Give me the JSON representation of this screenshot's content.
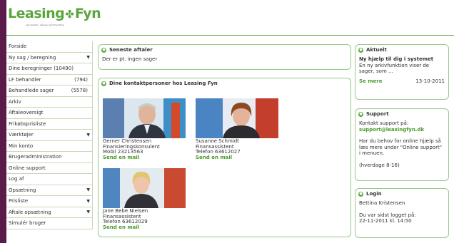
{
  "brand": {
    "name_a": "Leasing",
    "name_b": "Fyn",
    "tagline": "specialister i leasing og forhandling",
    "accent": "#5aa53c",
    "frame": "#5a1a4a"
  },
  "sidebar": {
    "items": [
      {
        "label": "Forside",
        "count": "",
        "arrow": false
      },
      {
        "label": "Ny sag / beregning",
        "count": "",
        "arrow": true
      },
      {
        "label": "Dine beregninger (10490)",
        "count": "",
        "arrow": false
      },
      {
        "label": "LF behandler",
        "count": "(794)",
        "arrow": false
      },
      {
        "label": "Behandlede sager",
        "count": "(5578)",
        "arrow": false
      },
      {
        "label": "Arkiv",
        "count": "",
        "arrow": false
      },
      {
        "label": "Aftaleoversigt",
        "count": "",
        "arrow": false
      },
      {
        "label": "Frikøbsprisliste",
        "count": "",
        "arrow": false
      },
      {
        "label": "Værktøjer",
        "count": "",
        "arrow": true
      },
      {
        "label": "Min konto",
        "count": "",
        "arrow": false
      },
      {
        "label": "Brugeradministration",
        "count": "",
        "arrow": false
      },
      {
        "label": "Online support",
        "count": "",
        "arrow": false
      },
      {
        "label": "Log af",
        "count": "",
        "arrow": false
      },
      {
        "label": "Opsætning",
        "count": "",
        "arrow": true
      },
      {
        "label": "Prisliste",
        "count": "",
        "arrow": true
      },
      {
        "label": "Aftale opsætning",
        "count": "",
        "arrow": true
      },
      {
        "label": "Simulér bruger",
        "count": "",
        "arrow": false
      }
    ]
  },
  "latest": {
    "title": "Seneste aftaler",
    "text": "Der er pt. ingen sager"
  },
  "contacts": {
    "title": "Dine kontaktpersoner hos Leasing Fyn",
    "people": [
      {
        "name": "Gerner Christensen",
        "role": "Finansieringskonsulent",
        "phone": "Mobil 23213563",
        "mail": "Send en mail"
      },
      {
        "name": "Susanne Schmidt",
        "role": "Finansassistent",
        "phone": "Telefon 63612027",
        "mail": "Send en mail"
      },
      {
        "name": "Jane Bebe Nielsen",
        "role": "Finansassistent",
        "phone": "Telefon 63612029",
        "mail": "Send en mail"
      }
    ]
  },
  "aktuelt": {
    "title": "Aktuelt",
    "headline": "Ny hjælp til dig i systemet",
    "body": "En ny arkivfunktion viser de sager, som ...",
    "more": "Se mere",
    "date": "13-10-2011"
  },
  "support": {
    "title": "Support",
    "line1": "Kontakt support på:",
    "email": "support@leasingfyn.dk",
    "body": "Har du behov for online hjælp så læs mere under \"Online support\" i menuen.",
    "hours": "(hverdage 8-16)"
  },
  "login": {
    "title": "Login",
    "user": "Bettina Kristensen",
    "last": "Du var sidst logget på:",
    "stamp": "22-11-2011 kl. 14:50"
  }
}
